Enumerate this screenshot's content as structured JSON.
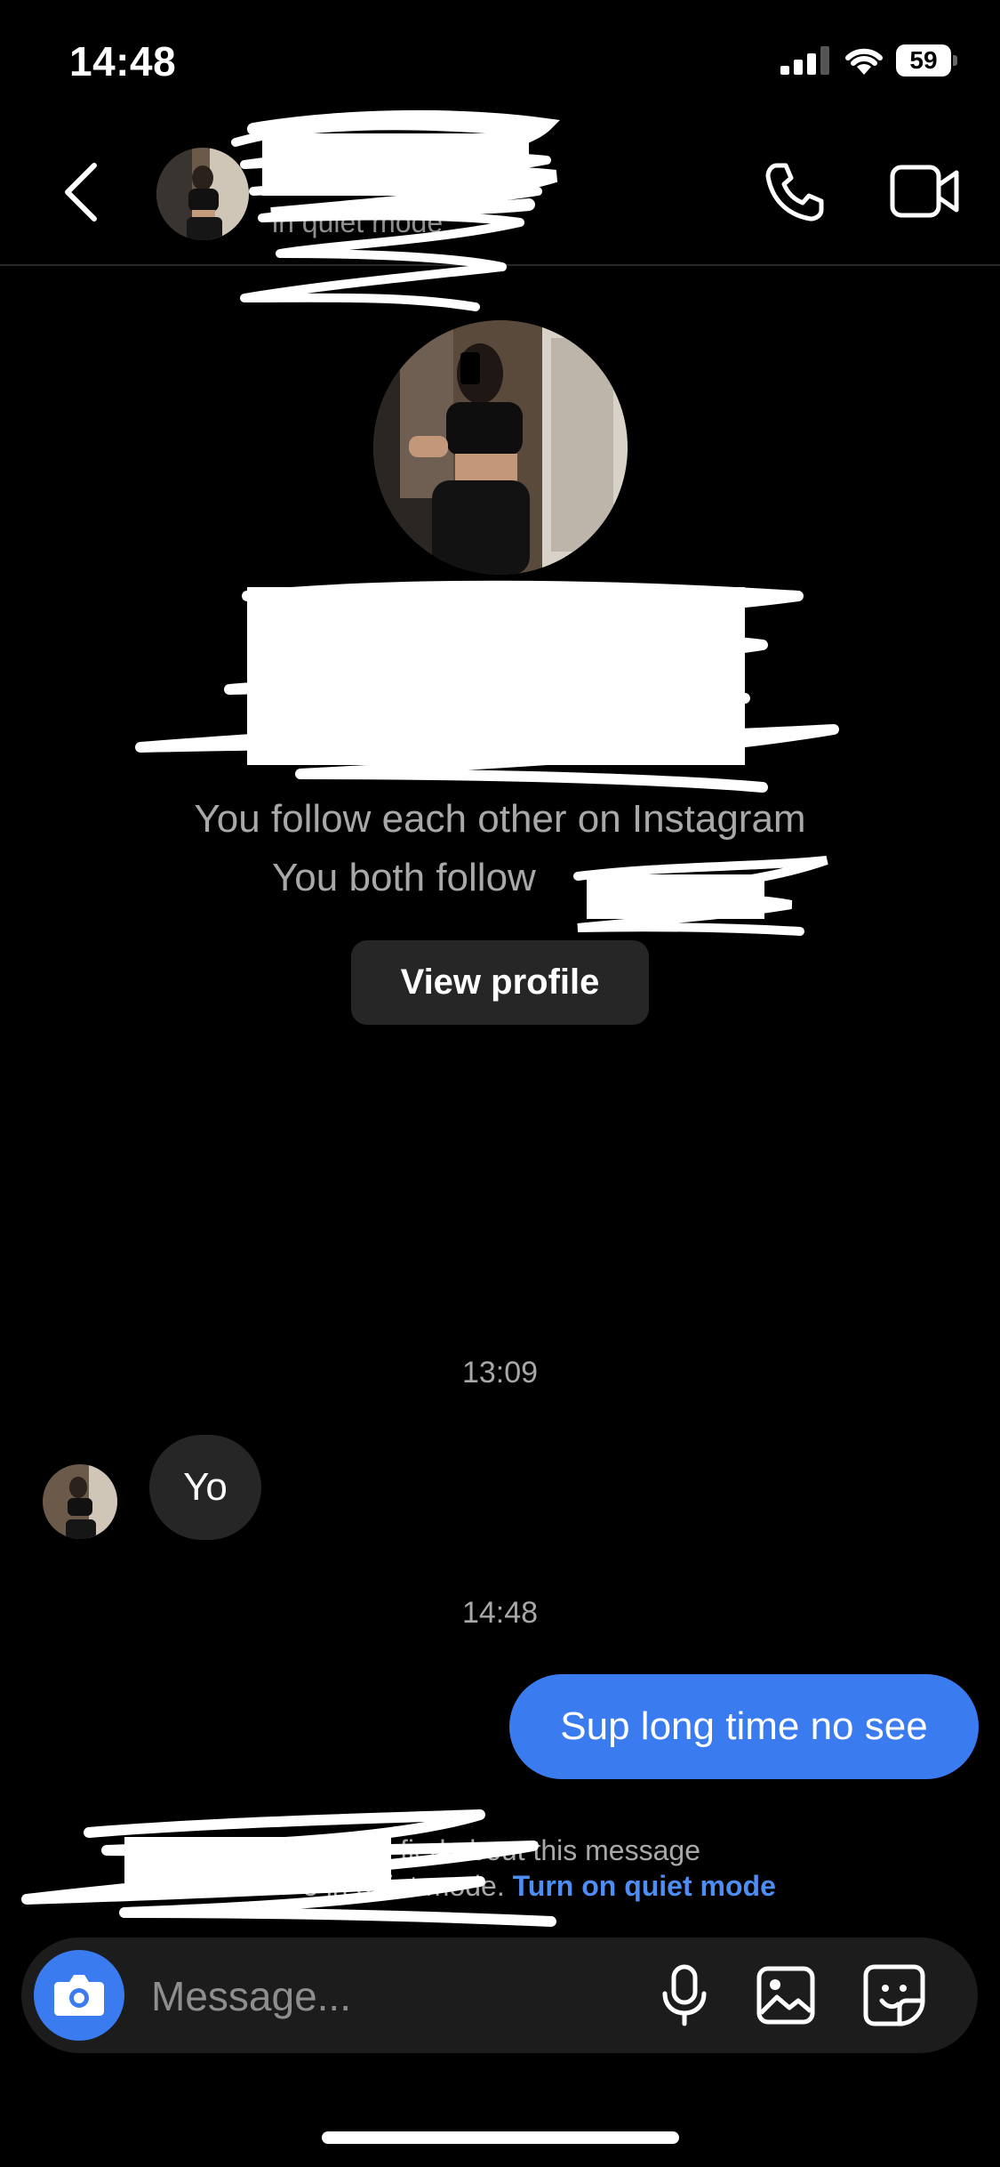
{
  "status_bar": {
    "time": "14:48",
    "battery": "59"
  },
  "header": {
    "subtitle": "in quiet mode"
  },
  "profile": {
    "follow_each_other": "You follow each other on Instagram",
    "both_follow": "You both follow",
    "view_profile_label": "View profile"
  },
  "chat": {
    "timestamp_1": "13:09",
    "incoming_message": "Yo",
    "timestamp_2": "14:48",
    "outgoing_message": "Sup long time no see"
  },
  "notice": {
    "line1": "fied about this message",
    "line2": "e in quiet mode.",
    "link": "Turn on quiet mode"
  },
  "composer": {
    "placeholder": "Message..."
  },
  "colors": {
    "accent": "#3a7bf0",
    "link": "#4d8ef5",
    "bubble_incoming": "#262626",
    "background": "#000000"
  }
}
